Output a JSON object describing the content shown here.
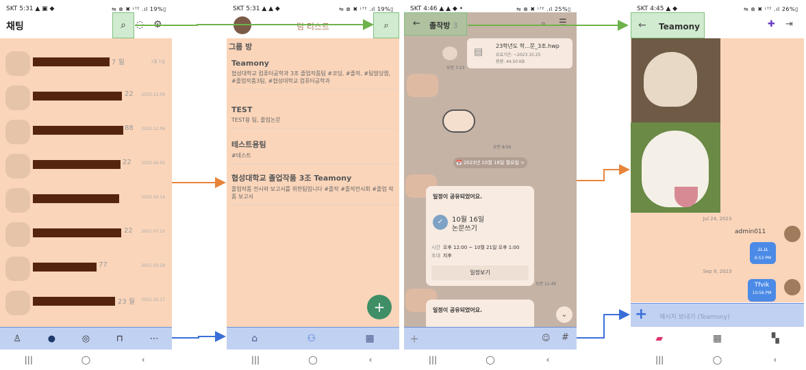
{
  "colors": {
    "highlight_orange": "#f6b282",
    "highlight_green": "#96d296",
    "highlight_blue": "#a0b9eb",
    "arrow_green": "#6db34a",
    "arrow_orange": "#e8843a",
    "arrow_blue": "#3a6fd8",
    "fab_green": "#3f8e66"
  },
  "screen1": {
    "status_left": "SKT 5:31 ▲ ▣ ◆",
    "status_right": "⇋ ⊗ ✖ ᴸᵀᴱ .ıl 19%▯",
    "title": "채팅",
    "icons": [
      "search-icon",
      "chat-bubble-icon",
      "settings-icon"
    ],
    "chats": [
      {
        "count": "7",
        "suffix": "월",
        "date": "1월 1일"
      },
      {
        "count": "22",
        "suffix": "",
        "date": "2022.12.09"
      },
      {
        "count": "88",
        "suffix": "",
        "date": "2022.12.06"
      },
      {
        "count": "22",
        "suffix": "",
        "date": "2022.06.02"
      },
      {
        "count": "",
        "suffix": "",
        "date": "2022.02.14"
      },
      {
        "count": "22",
        "suffix": "",
        "date": "2021.07.12"
      },
      {
        "count": "77",
        "suffix": "",
        "date": "2021.02.29"
      },
      {
        "count": "23",
        "suffix": "월",
        "date": "2021.02.17"
      }
    ],
    "tabbar": [
      "person-icon",
      "chat-icon",
      "open-chat-icon",
      "shop-icon",
      "more-icon"
    ]
  },
  "screen2": {
    "status_left": "SKT 5:31 ▲ ▲ ◆",
    "status_right": "⇋ ⊗ ✖ ᴸᵀᴱ .ıl 19%▯",
    "title": "팀 리스트",
    "section": "그룹 방",
    "rooms": [
      {
        "name": "Teamony",
        "desc": "협성대학교 컴퓨터공학과 3조 졸업작품팀 #코딩, #졸작, #팀빌딩앱, #졸업작품3팀, #협성대학교 컴퓨터공학과"
      },
      {
        "name": "TEST",
        "desc": "TEST용 팀, 졸업논문"
      },
      {
        "name": "테스트용팀",
        "desc": "#테스트"
      },
      {
        "name": "협성대학교 졸업작품 3조 Teamony",
        "desc": "졸업작품 전시와 보고서를 위한팀입니다 #졸작 #졸작전시회 #졸업 작품 보고서"
      }
    ],
    "fab": "+",
    "tabbar": [
      "home-icon",
      "team-icon",
      "calendar-icon"
    ]
  },
  "screen3": {
    "status_left": "SKT 4:46 ▲ ▲ ◆ •",
    "status_right": "⇋ ⊗ ✖ ᴸᵀᴱ .ıl 25%▯",
    "title": "졸작방",
    "member_count": "3",
    "file_name": "23학년도 학...문_3조.hwp",
    "file_expiry": "유효기간: ~2023.10.25",
    "file_size": "용량: 44.50 KB",
    "time1": "오전 7:23",
    "time2": "오전 8:56",
    "date_pill": "📅 2023년 10월 16일 월요일 >",
    "schedule_title": "일정이 공유되었어요.",
    "schedule_date": "10월 16일",
    "schedule_event": "논문쓰기",
    "time_label": "시간",
    "time_value": "오후 12:00 ~ 10월 21일 오후 1:00",
    "invite_label": "초대",
    "invite_value": "지후",
    "schedule_button": "일정보기",
    "time3": "오전 11:45",
    "schedule_title2": "일정이 공유되었어요."
  },
  "screen4": {
    "status_left": "SKT 4:45 ▲ ◆",
    "status_right": "⇋ ⊗ ✖ ᴸᵀᴱ .ıl 26%▯",
    "title": "Teamony",
    "date1": "Jul 24, 2023",
    "sender": "admin011",
    "msg1": "ㅛㅛ",
    "time1": "6:53 PM",
    "date2": "Sep 9, 2023",
    "msg2": "Tfvik",
    "time2": "10:56 PM",
    "input_placeholder": "메시지 보내기 (Teamony)",
    "tabbar": [
      "chat-tab-icon",
      "calendar-tab-icon",
      "dashboard-tab-icon"
    ]
  },
  "system_nav": [
    "|||",
    "◯",
    "‹"
  ]
}
